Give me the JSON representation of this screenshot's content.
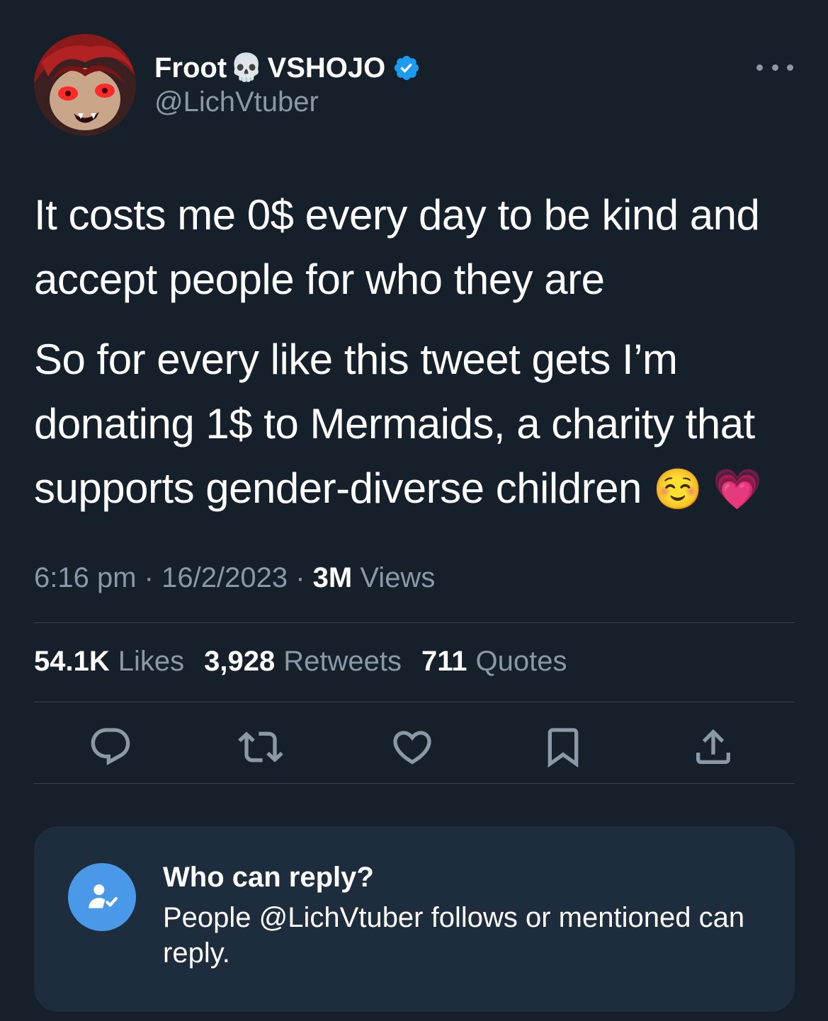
{
  "author": {
    "name_part1": "Froot",
    "name_emoji": "💀",
    "name_part2": "VSHOJO",
    "handle": "@LichVtuber",
    "verified": true
  },
  "tweet": {
    "paragraph1": "It costs me 0$ every day to be kind and accept people for who they are",
    "paragraph2": "So for every like this tweet gets I’m donating 1$ to Mermaids, a charity that supports gender-diverse children",
    "paragraph2_emojis": "☺️ 💗"
  },
  "meta": {
    "time": "6:16 pm",
    "separator": "·",
    "date": "16/2/2023",
    "views_count": "3M",
    "views_label": "Views"
  },
  "stats": {
    "likes_count": "54.1K",
    "likes_label": "Likes",
    "retweets_count": "3,928",
    "retweets_label": "Retweets",
    "quotes_count": "711",
    "quotes_label": "Quotes"
  },
  "actions": [
    {
      "icon": "reply-icon"
    },
    {
      "icon": "retweet-icon"
    },
    {
      "icon": "like-heart-icon"
    },
    {
      "icon": "bookmark-icon"
    },
    {
      "icon": "share-icon"
    }
  ],
  "reply_settings": {
    "title": "Who can reply?",
    "description": "People @LichVtuber follows or mentioned can reply."
  },
  "colors": {
    "background": "#15202b",
    "card": "#1e2d3d",
    "secondary_text": "#8b98a5",
    "verified_blue": "#1d9bf0",
    "accent_blue": "#4a99e9"
  }
}
